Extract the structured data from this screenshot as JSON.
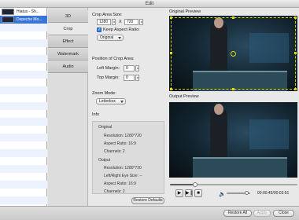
{
  "window": {
    "title": "Edit"
  },
  "files": [
    {
      "name": "Hiatus - Sh...",
      "selected": false
    },
    {
      "name": "Depeche Mo...",
      "selected": true
    }
  ],
  "tabs": [
    "3D",
    "Crop",
    "Effect",
    "Watermark",
    "Audio"
  ],
  "active_tab": "Crop",
  "crop": {
    "area_size_label": "Crop Area Size:",
    "width": "1280",
    "separator": "X",
    "height": "720",
    "keep_aspect_label": "Keep Aspect Ratio:",
    "keep_aspect_checked": true,
    "aspect_option": "Original",
    "position_label": "Position of Crop Area:",
    "left_margin_label": "Left Margin:",
    "left_margin": "0",
    "top_margin_label": "Top Margin:",
    "top_margin": "0",
    "zoom_label": "Zoom Mode:",
    "zoom_option": "Letterbox"
  },
  "info": {
    "heading": "Info",
    "original_label": "Original",
    "original_resolution": "Resolution: 1280*720",
    "original_aspect": "Aspect Ratio: 16:9",
    "original_channels": "Channels: 2",
    "output_label": "Output",
    "output_resolution": "Resolution: 1280*720",
    "output_eye_size": "Left/Right Eye Size: --",
    "output_aspect": "Aspect Ratio: 16:9",
    "output_channels": "Channels: 2"
  },
  "restore_defaults": "Restore Defaults",
  "preview": {
    "original_label": "Original Preview",
    "output_label": "Output Preview",
    "time": "00:00:45/00:03:51",
    "progress": 0.2,
    "volume": 0.85
  },
  "footer": {
    "restore_all": "Restore All",
    "apply": "Apply",
    "close": "Close"
  }
}
